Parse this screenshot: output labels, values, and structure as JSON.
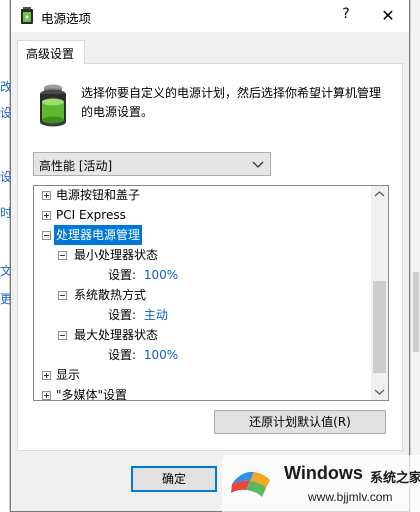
{
  "window": {
    "title": "电源选项",
    "help": "?",
    "close": "✕"
  },
  "background": {
    "left_chars": [
      "改",
      "设",
      "设",
      "时",
      "文",
      "更"
    ]
  },
  "tab": {
    "label": "高级设置"
  },
  "description": "选择你要自定义的电源计划，然后选择你希望计算机管理的电源设置。",
  "plan_select": {
    "value": "高性能 [活动]"
  },
  "tree": [
    {
      "label": "电源按钮和盖子",
      "state": "collapsed"
    },
    {
      "label": "PCI Express",
      "state": "collapsed"
    },
    {
      "label": "处理器电源管理",
      "state": "expanded",
      "selected": true
    },
    {
      "label": "最小处理器状态",
      "state": "expanded"
    },
    {
      "label": "设置:",
      "value": "100%"
    },
    {
      "label": "系统散热方式",
      "state": "expanded"
    },
    {
      "label": "设置:",
      "value": "主动"
    },
    {
      "label": "最大处理器状态",
      "state": "expanded"
    },
    {
      "label": "设置:",
      "value": "100%"
    },
    {
      "label": "显示",
      "state": "collapsed"
    },
    {
      "label": "\"多媒体\"设置",
      "state": "collapsed"
    }
  ],
  "buttons": {
    "restore": "还原计划默认值(R)",
    "ok": "确定"
  },
  "watermark": {
    "title": "Windows",
    "subtitle": "系统之家",
    "url": "www.bjjmlv.com"
  },
  "colors": {
    "selection": "#0078d7",
    "value_text": "#0f63c7",
    "dialog_bg": "#f0f0f0"
  }
}
